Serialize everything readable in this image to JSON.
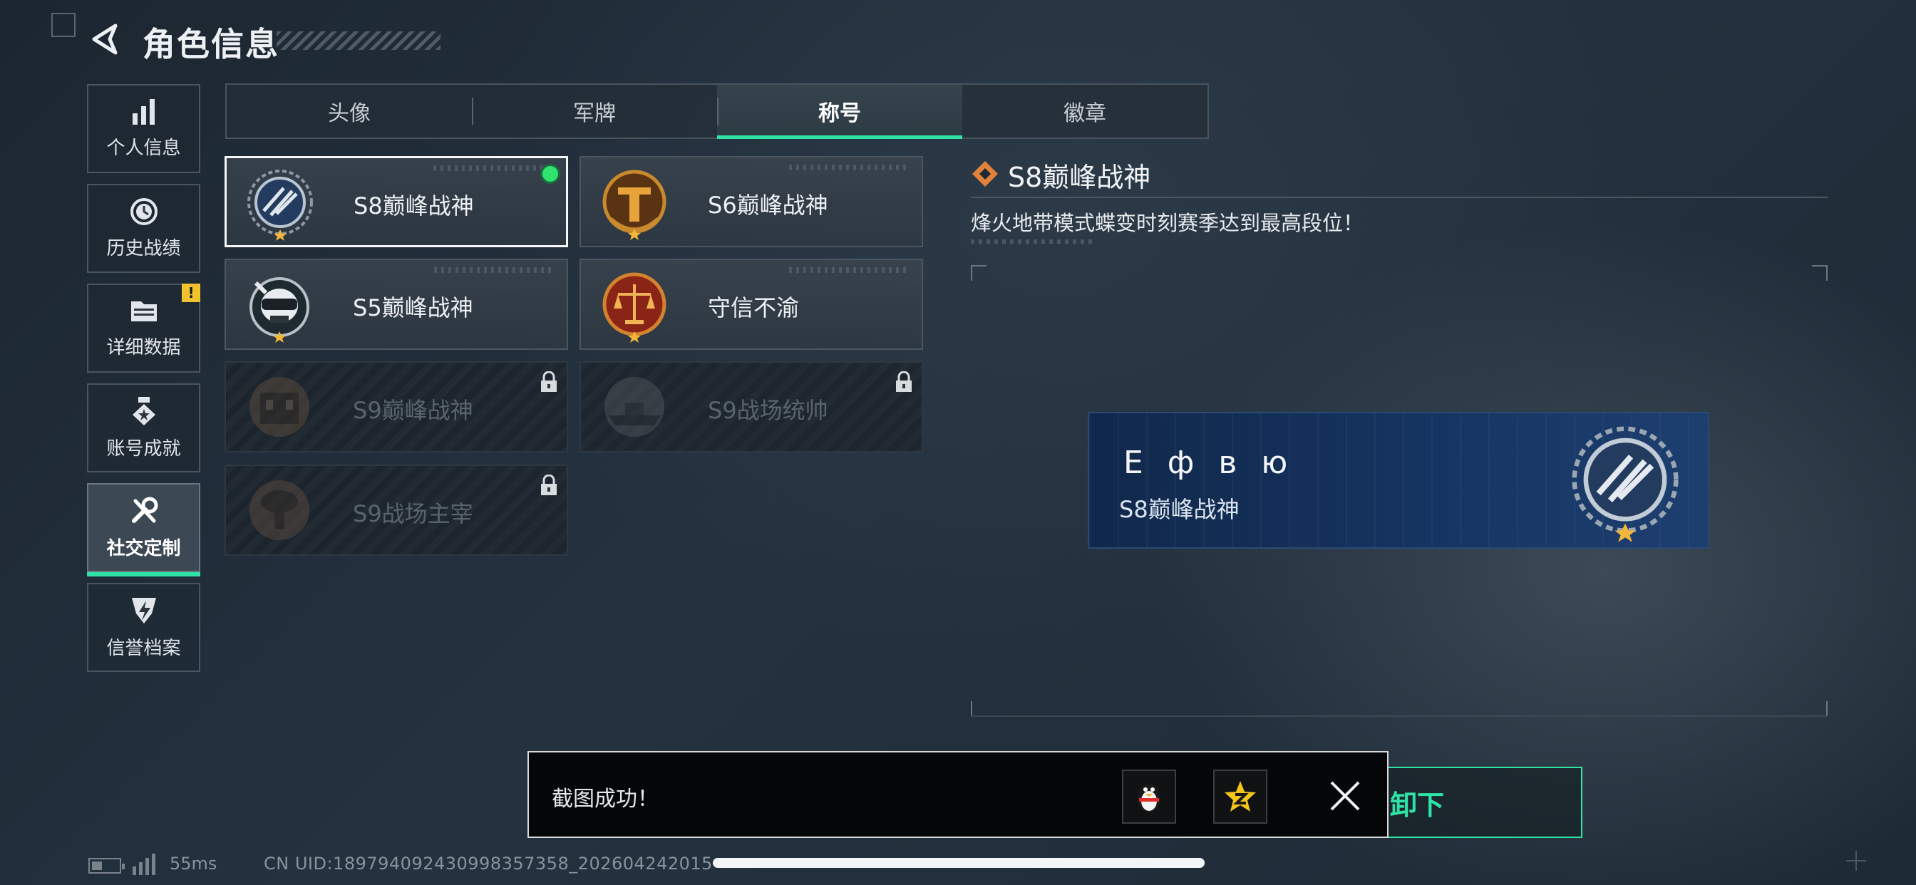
{
  "header": {
    "title": "角色信息"
  },
  "sidebar": {
    "items": [
      {
        "label": "个人信息",
        "icon": "bar-chart-icon"
      },
      {
        "label": "历史战绩",
        "icon": "history-clock-icon"
      },
      {
        "label": "详细数据",
        "icon": "folder-icon",
        "badge": "!"
      },
      {
        "label": "账号成就",
        "icon": "achievement-medal-icon"
      },
      {
        "label": "社交定制",
        "icon": "wrench-screwdriver-icon",
        "active": true
      },
      {
        "label": "信誉档案",
        "icon": "shield-badge-icon"
      }
    ]
  },
  "tabs": [
    {
      "label": "头像"
    },
    {
      "label": "军牌"
    },
    {
      "label": "称号",
      "active": true
    },
    {
      "label": "徽章"
    }
  ],
  "titles": [
    {
      "name": "S8巅峰战神",
      "emblem": "s8-emblem-icon",
      "selected": true,
      "equipped": true,
      "locked": false
    },
    {
      "name": "S6巅峰战神",
      "emblem": "s6-emblem-icon",
      "locked": false
    },
    {
      "name": "S5巅峰战神",
      "emblem": "skull-emblem-icon",
      "locked": false
    },
    {
      "name": "守信不渝",
      "emblem": "scales-emblem-icon",
      "locked": false
    },
    {
      "name": "S9巅峰战神",
      "emblem": "building-emblem-icon",
      "locked": true
    },
    {
      "name": "S9战场统帅",
      "emblem": "warship-emblem-icon",
      "locked": true
    },
    {
      "name": "S9战场主宰",
      "emblem": "mushroom-cloud-emblem-icon",
      "locked": true
    }
  ],
  "detail": {
    "title": "S8巅峰战神",
    "description": "烽火地带模式蝶变时刻赛季达到最高段位！"
  },
  "nameplate": {
    "player_name": "Е ф в ю",
    "title": "S8巅峰战神"
  },
  "toast": {
    "text": "截图成功！",
    "share_targets": [
      "qq-penguin-icon",
      "qzone-star-icon"
    ]
  },
  "confirm_button": {
    "label": "卸下"
  },
  "status_bar": {
    "ping": "55ms",
    "uid": "CN UID:18979409243099835735​8_202604242015"
  },
  "colors": {
    "accent": "#2fe3a5",
    "equipped": "#2fe36e",
    "warning": "#f2c12e",
    "nameplate": "#163461"
  }
}
